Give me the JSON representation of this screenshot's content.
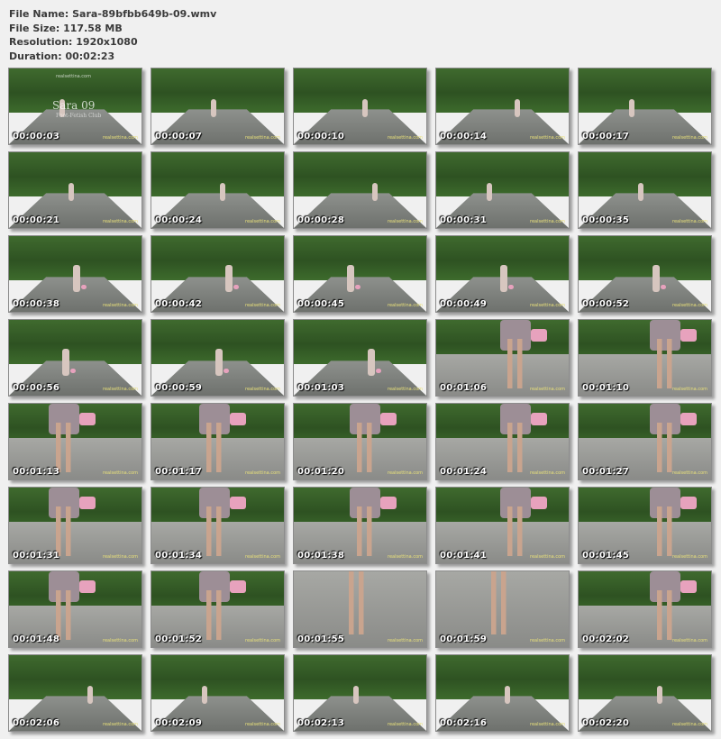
{
  "file_info": {
    "file_name": "File Name: Sara-89bfbb649b-09.wmv",
    "file_size": "File Size: 117.58 MB",
    "resolution": "Resolution: 1920x1080",
    "duration": "Duration: 00:02:23"
  },
  "first_thumb_overlay": {
    "title": "Sara 09",
    "subtitle": "Foot-Fetish Club",
    "top_text": "realsettina.com"
  },
  "watermark": "realsettina.com",
  "colors": {
    "background": "#f0f0f0",
    "info_text": "#3a3a3a",
    "timestamp": "#ffffff",
    "watermark": "#e8e07a"
  },
  "thumbnails": [
    {
      "time": "00:00:03",
      "scene": "road-title"
    },
    {
      "time": "00:00:07",
      "scene": "road-far"
    },
    {
      "time": "00:00:10",
      "scene": "road-far"
    },
    {
      "time": "00:00:14",
      "scene": "road-far"
    },
    {
      "time": "00:00:17",
      "scene": "road-far"
    },
    {
      "time": "00:00:21",
      "scene": "road-far"
    },
    {
      "time": "00:00:24",
      "scene": "road-far"
    },
    {
      "time": "00:00:28",
      "scene": "road-far"
    },
    {
      "time": "00:00:31",
      "scene": "road-far"
    },
    {
      "time": "00:00:35",
      "scene": "road-far"
    },
    {
      "time": "00:00:38",
      "scene": "road-mid"
    },
    {
      "time": "00:00:42",
      "scene": "road-mid"
    },
    {
      "time": "00:00:45",
      "scene": "road-mid"
    },
    {
      "time": "00:00:49",
      "scene": "road-mid"
    },
    {
      "time": "00:00:52",
      "scene": "road-mid"
    },
    {
      "time": "00:00:56",
      "scene": "road-mid"
    },
    {
      "time": "00:00:59",
      "scene": "road-mid"
    },
    {
      "time": "00:01:03",
      "scene": "road-mid"
    },
    {
      "time": "00:01:06",
      "scene": "close-dress"
    },
    {
      "time": "00:01:10",
      "scene": "close-dress"
    },
    {
      "time": "00:01:13",
      "scene": "close-legs"
    },
    {
      "time": "00:01:17",
      "scene": "close-legs"
    },
    {
      "time": "00:01:20",
      "scene": "close-legs"
    },
    {
      "time": "00:01:24",
      "scene": "close-legs"
    },
    {
      "time": "00:01:27",
      "scene": "close-legs"
    },
    {
      "time": "00:01:31",
      "scene": "close-legs"
    },
    {
      "time": "00:01:34",
      "scene": "close-legs"
    },
    {
      "time": "00:01:38",
      "scene": "close-legs"
    },
    {
      "time": "00:01:41",
      "scene": "close-legs"
    },
    {
      "time": "00:01:45",
      "scene": "close-legs"
    },
    {
      "time": "00:01:48",
      "scene": "close-legs"
    },
    {
      "time": "00:01:52",
      "scene": "close-legs"
    },
    {
      "time": "00:01:55",
      "scene": "ground-feet"
    },
    {
      "time": "00:01:59",
      "scene": "ground-feet"
    },
    {
      "time": "00:02:02",
      "scene": "close-legs"
    },
    {
      "time": "00:02:06",
      "scene": "road-far"
    },
    {
      "time": "00:02:09",
      "scene": "road-far"
    },
    {
      "time": "00:02:13",
      "scene": "road-far"
    },
    {
      "time": "00:02:16",
      "scene": "road-far"
    },
    {
      "time": "00:02:20",
      "scene": "road-far"
    }
  ]
}
